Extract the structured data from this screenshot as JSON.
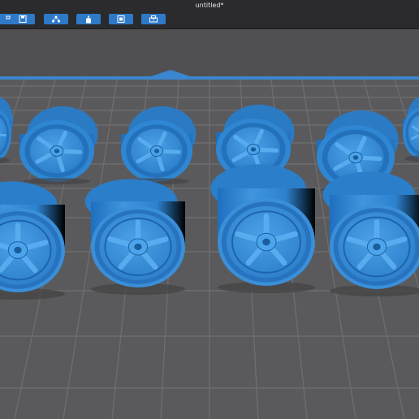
{
  "window": {
    "title": "untitled*"
  },
  "toolbar": {
    "buttons": [
      {
        "icon": "arrange-icon"
      },
      {
        "icon": "save-icon"
      },
      {
        "icon": "supports-icon"
      },
      {
        "icon": "resin-bottle-icon"
      },
      {
        "icon": "slice-icon"
      },
      {
        "icon": "print-icon"
      }
    ]
  },
  "scene": {
    "model_color": "#3d8fd6",
    "model_dark": "#1f5f9e",
    "plate_color": "#5c5c5e",
    "plate_grid_color": "#6d6d70",
    "plate_edge_color": "#3a86d0",
    "back_row_wheels": 6,
    "front_row_wheels": 4
  }
}
